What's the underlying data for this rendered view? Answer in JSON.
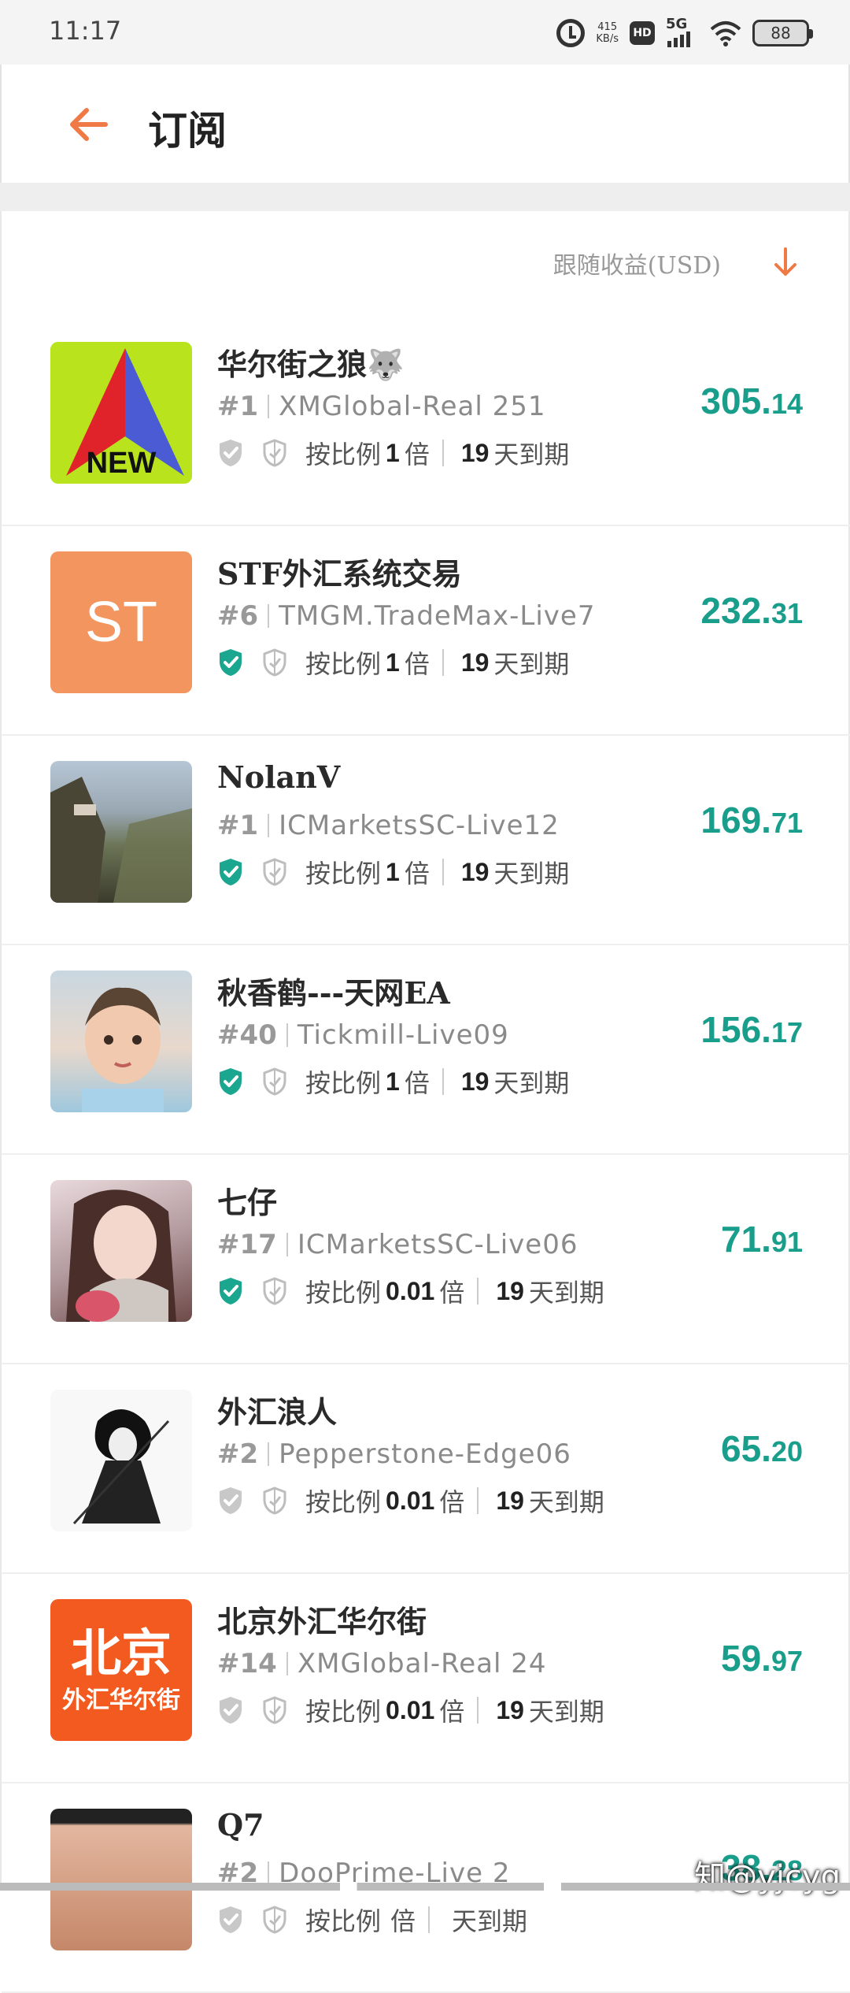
{
  "status_bar": {
    "time": "11:17",
    "net_speed_value": "415",
    "net_speed_unit": "KB/s",
    "hd_label": "HD",
    "network": "5G",
    "battery": "88",
    "icons": [
      "alarm-icon",
      "hd-icon",
      "signal-icon",
      "wifi-icon",
      "battery-icon"
    ]
  },
  "header": {
    "back_icon": "arrow-left-icon",
    "title": "订阅",
    "accent_color": "#f07a45"
  },
  "sort": {
    "label": "跟随收益(USD)",
    "icon": "arrow-down-icon"
  },
  "items": [
    {
      "name": "华尔街之狼🐺",
      "rank": "#1",
      "account": "XMGlobal-Real 251",
      "verified": false,
      "ratio_prefix": "按比例",
      "ratio": "1",
      "ratio_suffix": "倍",
      "days": "19",
      "days_suffix": "天到期",
      "profit_int": "305.",
      "profit_dec": "14",
      "avatar": "new-logo"
    },
    {
      "name": "STF外汇系统交易",
      "rank": "#6",
      "account": "TMGM.TradeMax-Live7",
      "verified": true,
      "ratio_prefix": "按比例",
      "ratio": "1",
      "ratio_suffix": "倍",
      "days": "19",
      "days_suffix": "天到期",
      "profit_int": "232.",
      "profit_dec": "31",
      "avatar": "ST"
    },
    {
      "name": "NolanV",
      "rank": "#1",
      "account": "ICMarketsSC-Live12",
      "verified": true,
      "ratio_prefix": "按比例",
      "ratio": "1",
      "ratio_suffix": "倍",
      "days": "19",
      "days_suffix": "天到期",
      "profit_int": "169.",
      "profit_dec": "71",
      "avatar": "mountain-photo"
    },
    {
      "name": "秋香鹤---天网EA",
      "rank": "#40",
      "account": "Tickmill-Live09",
      "verified": true,
      "ratio_prefix": "按比例",
      "ratio": "1",
      "ratio_suffix": "倍",
      "days": "19",
      "days_suffix": "天到期",
      "profit_int": "156.",
      "profit_dec": "17",
      "avatar": "child-photo"
    },
    {
      "name": "七仔",
      "rank": "#17",
      "account": "ICMarketsSC-Live06",
      "verified": true,
      "ratio_prefix": "按比例",
      "ratio": "0.01",
      "ratio_suffix": "倍",
      "days": "19",
      "days_suffix": "天到期",
      "profit_int": "71.",
      "profit_dec": "91",
      "avatar": "girl-photo"
    },
    {
      "name": "外汇浪人",
      "rank": "#2",
      "account": "Pepperstone-Edge06",
      "verified": false,
      "ratio_prefix": "按比例",
      "ratio": "0.01",
      "ratio_suffix": "倍",
      "days": "19",
      "days_suffix": "天到期",
      "profit_int": "65.",
      "profit_dec": "20",
      "avatar": "ink-warrior"
    },
    {
      "name": "北京外汇华尔街",
      "rank": "#14",
      "account": "XMGlobal-Real 24",
      "verified": false,
      "ratio_prefix": "按比例",
      "ratio": "0.01",
      "ratio_suffix": "倍",
      "days": "19",
      "days_suffix": "天到期",
      "profit_int": "59.",
      "profit_dec": "97",
      "avatar": "beijing-logo"
    },
    {
      "name": "Q7",
      "rank": "#2",
      "account": "DooPrime-Live 2",
      "verified": false,
      "ratio_prefix": "按比例",
      "ratio": "",
      "ratio_suffix": "倍",
      "days": "",
      "days_suffix": "天到期",
      "profit_int": "38.",
      "profit_dec": "28",
      "avatar": "woman-photo"
    }
  ],
  "avatar_text": {
    "st": "ST",
    "new_logo": "NEW",
    "beijing_top": "北京",
    "beijing_bottom": "外汇华尔街"
  },
  "watermark": "知@yjcyg",
  "colors": {
    "profit": "#1a9e8c",
    "verified": "#1aa68f",
    "unverified": "#c8c8c8"
  }
}
